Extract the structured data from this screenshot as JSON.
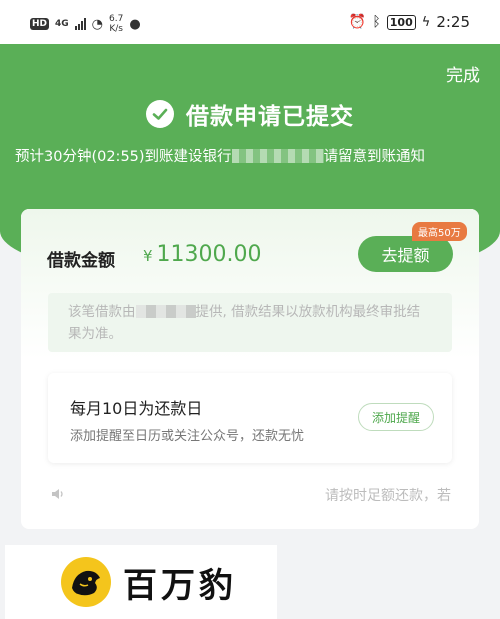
{
  "status_bar": {
    "hd": "HD",
    "network": "4G",
    "speed_value": "6.7",
    "speed_unit": "K/s",
    "battery": "100",
    "time": "2:25"
  },
  "header": {
    "done_label": "完成",
    "title": "借款申请已提交",
    "subtitle_prefix": "预计30分钟(02:55)到账建设银行",
    "subtitle_suffix": "请留意到账通知"
  },
  "loan": {
    "amount_label": "借款金额",
    "currency": "¥",
    "amount": "11300.00",
    "withdraw_label": "去提额",
    "limit_badge": "最高50万",
    "notice_prefix": "该笔借款由",
    "notice_suffix": "提供, 借款结果以放款机构最终审批结果为准。"
  },
  "repayment": {
    "title": "每月10日为还款日",
    "desc": "添加提醒至日历或关注公众号，还款无忧",
    "remind_label": "添加提醒"
  },
  "ticker": {
    "text": "请按时足额还款，若"
  },
  "watermark": {
    "text": "百万豹"
  },
  "colors": {
    "brand_green": "#5aaf57",
    "badge_orange": "#e87a42"
  }
}
